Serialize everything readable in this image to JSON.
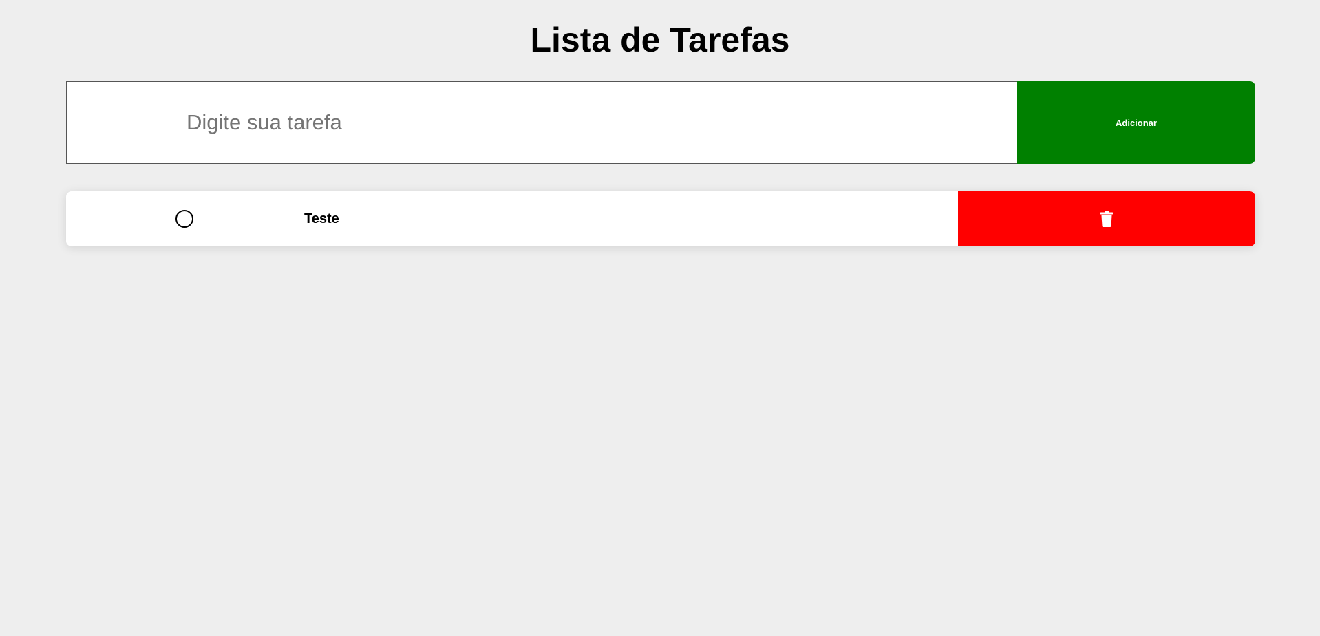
{
  "header": {
    "title": "Lista de Tarefas"
  },
  "form": {
    "input_value": "",
    "input_placeholder": "Digite sua tarefa",
    "add_button_label": "Adicionar"
  },
  "tasks": [
    {
      "text": "Teste",
      "completed": false,
      "check_icon": "circle-outline-icon",
      "delete_icon": "trash-icon"
    }
  ],
  "colors": {
    "background": "#eeeeee",
    "add_button": "#008000",
    "delete_button": "#ff0000",
    "text": "#000000",
    "placeholder": "#757575"
  }
}
